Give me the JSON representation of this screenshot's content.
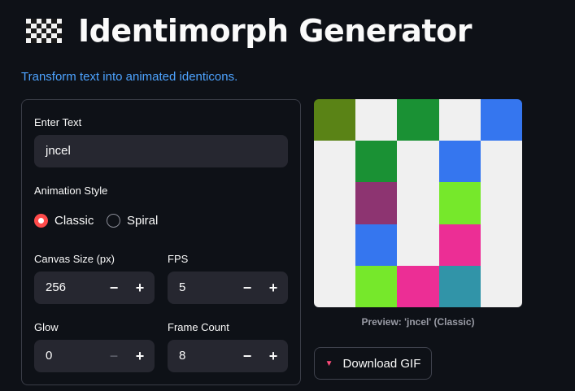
{
  "header": {
    "title": "Identimorph Generator",
    "subtitle": "Transform text into animated identicons."
  },
  "form": {
    "text_label": "Enter Text",
    "text_value": "jncel",
    "style_label": "Animation Style",
    "style_options": [
      "Classic",
      "Spiral"
    ],
    "style_selected": "Classic",
    "canvas_label": "Canvas Size (px)",
    "canvas_value": "256",
    "fps_label": "FPS",
    "fps_value": "5",
    "glow_label": "Glow",
    "glow_value": "0",
    "frames_label": "Frame Count",
    "frames_value": "8",
    "minus": "−",
    "plus": "+"
  },
  "preview": {
    "caption": "Preview: 'jncel' (Classic)",
    "grid": [
      [
        "#5a8316",
        "#f0f0f0",
        "#1a9134",
        "#f0f0f0",
        "#3576ef"
      ],
      [
        "#f0f0f0",
        "#1a9134",
        "#f0f0f0",
        "#3576ef",
        "#f0f0f0"
      ],
      [
        "#f0f0f0",
        "#8d3471",
        "#f0f0f0",
        "#76e82b",
        "#f0f0f0"
      ],
      [
        "#f0f0f0",
        "#3576ef",
        "#f0f0f0",
        "#ec2e95",
        "#f0f0f0"
      ],
      [
        "#f0f0f0",
        "#76e82b",
        "#ec2e95",
        "#3194a8",
        "#f0f0f0"
      ]
    ]
  },
  "download": {
    "label": "Download GIF",
    "arrow_icon": "▼"
  },
  "colors": {
    "accent": "#ff4b4b",
    "link": "#4da3ff",
    "background": "#0e1117"
  }
}
